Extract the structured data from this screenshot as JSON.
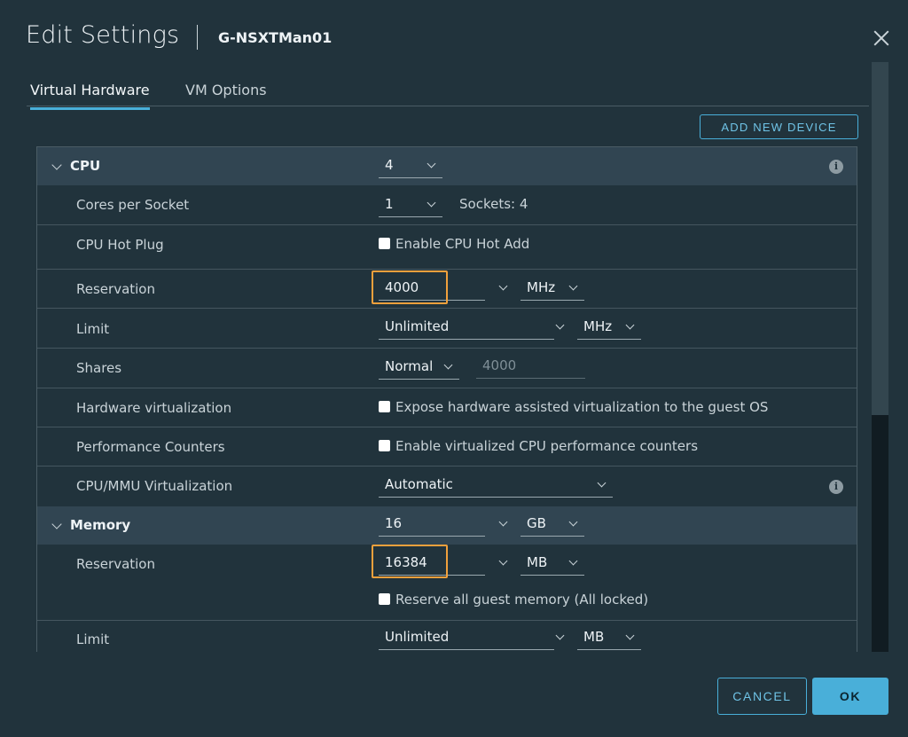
{
  "header": {
    "title": "Edit Settings",
    "vm_name": "G-NSXTMan01"
  },
  "tabs": [
    {
      "label": "Virtual Hardware",
      "active": true
    },
    {
      "label": "VM Options",
      "active": false
    }
  ],
  "toolbar": {
    "add_device_label": "ADD NEW DEVICE"
  },
  "cpu": {
    "label": "CPU",
    "count": "4",
    "cores_per_socket": {
      "label": "Cores per Socket",
      "value": "1",
      "sockets_text": "Sockets: 4"
    },
    "hot_plug": {
      "label": "CPU Hot Plug",
      "checkbox_label": "Enable CPU Hot Add",
      "checked": false
    },
    "reservation": {
      "label": "Reservation",
      "value": "4000",
      "unit": "MHz"
    },
    "limit": {
      "label": "Limit",
      "value": "Unlimited",
      "unit": "MHz"
    },
    "shares": {
      "label": "Shares",
      "level": "Normal",
      "value": "4000"
    },
    "hw_virtualization": {
      "label": "Hardware virtualization",
      "checkbox_label": "Expose hardware assisted virtualization to the guest OS",
      "checked": false
    },
    "perf_counters": {
      "label": "Performance Counters",
      "checkbox_label": "Enable virtualized CPU performance counters",
      "checked": false
    },
    "mmu_virtualization": {
      "label": "CPU/MMU Virtualization",
      "value": "Automatic"
    }
  },
  "memory": {
    "label": "Memory",
    "size": "16",
    "unit": "GB",
    "reservation": {
      "label": "Reservation",
      "value": "16384",
      "unit": "MB",
      "reserve_all_label": "Reserve all guest memory (All locked)",
      "reserve_all_checked": false
    },
    "limit": {
      "label": "Limit",
      "value": "Unlimited",
      "unit": "MB"
    }
  },
  "footer": {
    "cancel_label": "CANCEL",
    "ok_label": "OK"
  },
  "colors": {
    "accent": "#49afd9",
    "highlight": "#f0a03c",
    "background": "#21333c",
    "section_bg": "#314552"
  }
}
